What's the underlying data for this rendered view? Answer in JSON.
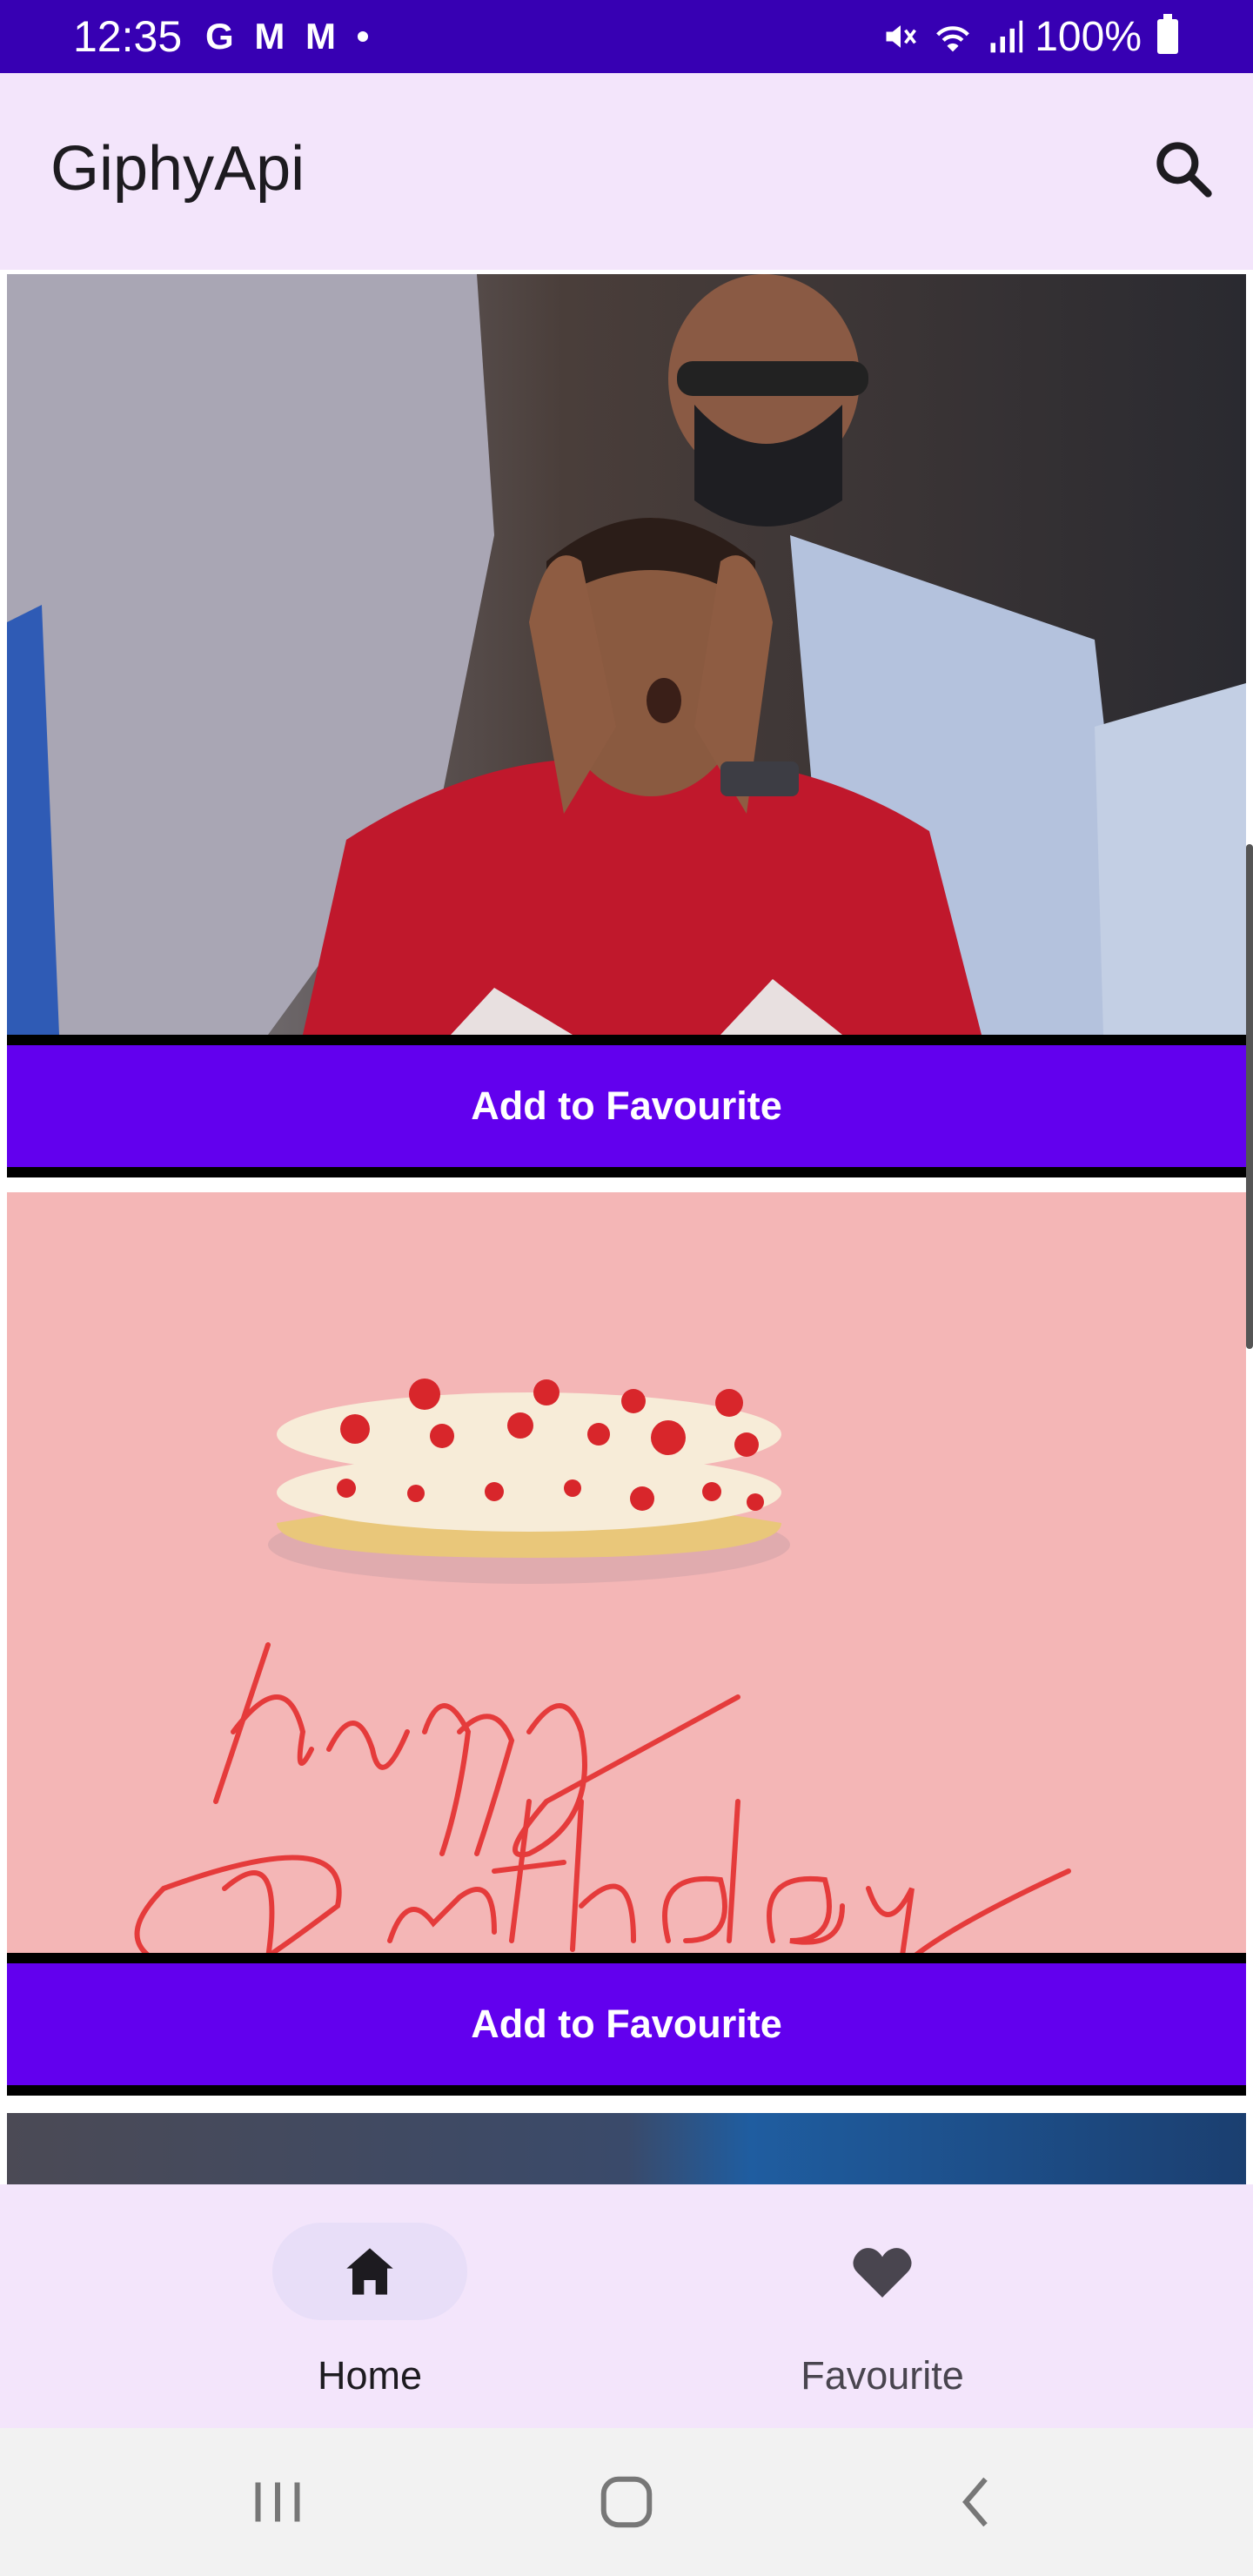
{
  "status_bar": {
    "time": "12:35",
    "notification_icons": "G M M •",
    "battery": "100%",
    "icons": [
      "mute-icon",
      "wifi-icon",
      "signal-icon",
      "battery-icon"
    ]
  },
  "app_bar": {
    "title": "GiphyApi",
    "search_icon": "search-icon"
  },
  "feed": {
    "items": [
      {
        "button_label": "Add to Favourite"
      },
      {
        "button_label": "Add to Favourite"
      }
    ]
  },
  "bottom_nav": {
    "items": [
      {
        "label": "Home",
        "icon": "home-icon",
        "selected": true
      },
      {
        "label": "Favourite",
        "icon": "heart-icon",
        "selected": false
      }
    ]
  },
  "system_nav": {
    "icons": [
      "recents-icon",
      "home-circle-icon",
      "back-icon"
    ]
  },
  "colors": {
    "status_bar": "#3700b3",
    "button": "#6200ee",
    "surface": "#f3e5fb"
  }
}
